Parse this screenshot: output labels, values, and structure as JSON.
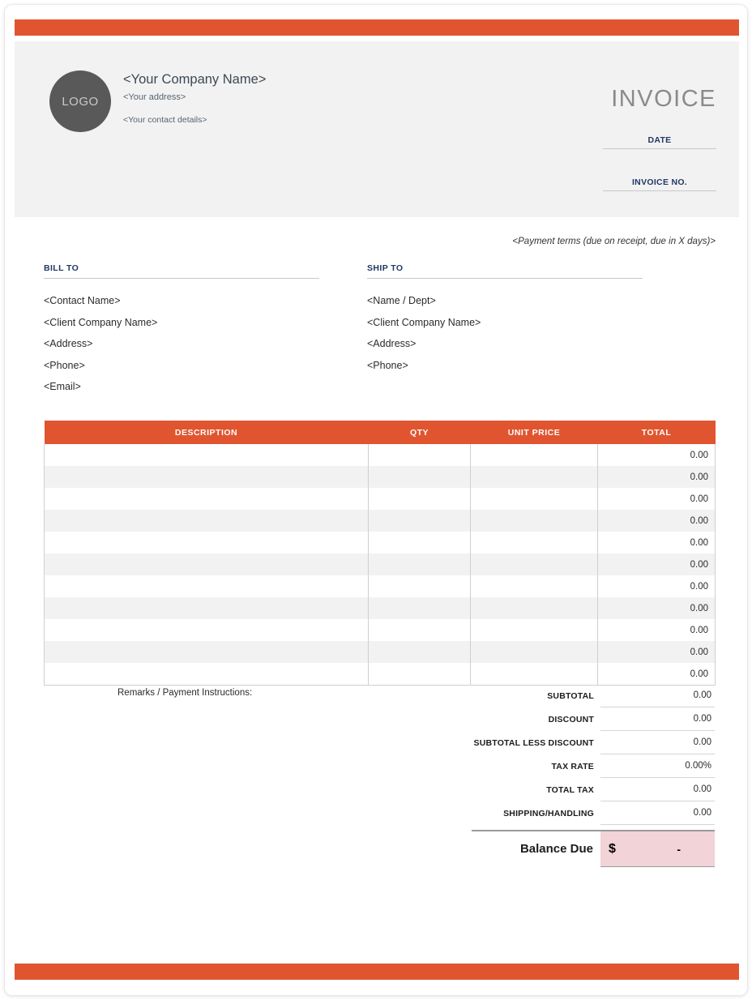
{
  "document": {
    "type": "invoice-template",
    "accent_color": "#e0552f",
    "header_band_color": "#f2f2f2",
    "label_color": "#203864",
    "balance_highlight_color": "#f2d3d7"
  },
  "header": {
    "logo_text": "LOGO",
    "company_name": "<Your Company Name>",
    "company_address": "<Your address>",
    "company_contact": "<Your contact details>",
    "title": "INVOICE",
    "date_label": "DATE",
    "date_value": "",
    "invoice_no_label": "INVOICE NO.",
    "invoice_no_value": ""
  },
  "payment_terms": "<Payment terms (due on receipt, due in X days)>",
  "bill_to": {
    "title": "BILL TO",
    "lines": [
      "<Contact Name>",
      "<Client Company Name>",
      "<Address>",
      "<Phone>",
      "<Email>"
    ]
  },
  "ship_to": {
    "title": "SHIP TO",
    "lines": [
      "<Name / Dept>",
      "<Client Company Name>",
      "<Address>",
      "<Phone>"
    ]
  },
  "items_table": {
    "columns": [
      "DESCRIPTION",
      "QTY",
      "UNIT PRICE",
      "TOTAL"
    ],
    "rows": [
      {
        "description": "",
        "qty": "",
        "unit_price": "",
        "total": "0.00"
      },
      {
        "description": "",
        "qty": "",
        "unit_price": "",
        "total": "0.00"
      },
      {
        "description": "",
        "qty": "",
        "unit_price": "",
        "total": "0.00"
      },
      {
        "description": "",
        "qty": "",
        "unit_price": "",
        "total": "0.00"
      },
      {
        "description": "",
        "qty": "",
        "unit_price": "",
        "total": "0.00"
      },
      {
        "description": "",
        "qty": "",
        "unit_price": "",
        "total": "0.00"
      },
      {
        "description": "",
        "qty": "",
        "unit_price": "",
        "total": "0.00"
      },
      {
        "description": "",
        "qty": "",
        "unit_price": "",
        "total": "0.00"
      },
      {
        "description": "",
        "qty": "",
        "unit_price": "",
        "total": "0.00"
      },
      {
        "description": "",
        "qty": "",
        "unit_price": "",
        "total": "0.00"
      },
      {
        "description": "",
        "qty": "",
        "unit_price": "",
        "total": "0.00"
      }
    ]
  },
  "remarks_label": "Remarks / Payment Instructions:",
  "totals": {
    "rows": [
      {
        "label": "SUBTOTAL",
        "value": "0.00"
      },
      {
        "label": "DISCOUNT",
        "value": "0.00"
      },
      {
        "label": "SUBTOTAL LESS DISCOUNT",
        "value": "0.00"
      },
      {
        "label": "TAX RATE",
        "value": "0.00%"
      },
      {
        "label": "TOTAL TAX",
        "value": "0.00"
      },
      {
        "label": "SHIPPING/HANDLING",
        "value": "0.00"
      }
    ],
    "balance_due_label": "Balance Due",
    "balance_currency": "$",
    "balance_value": "-"
  }
}
